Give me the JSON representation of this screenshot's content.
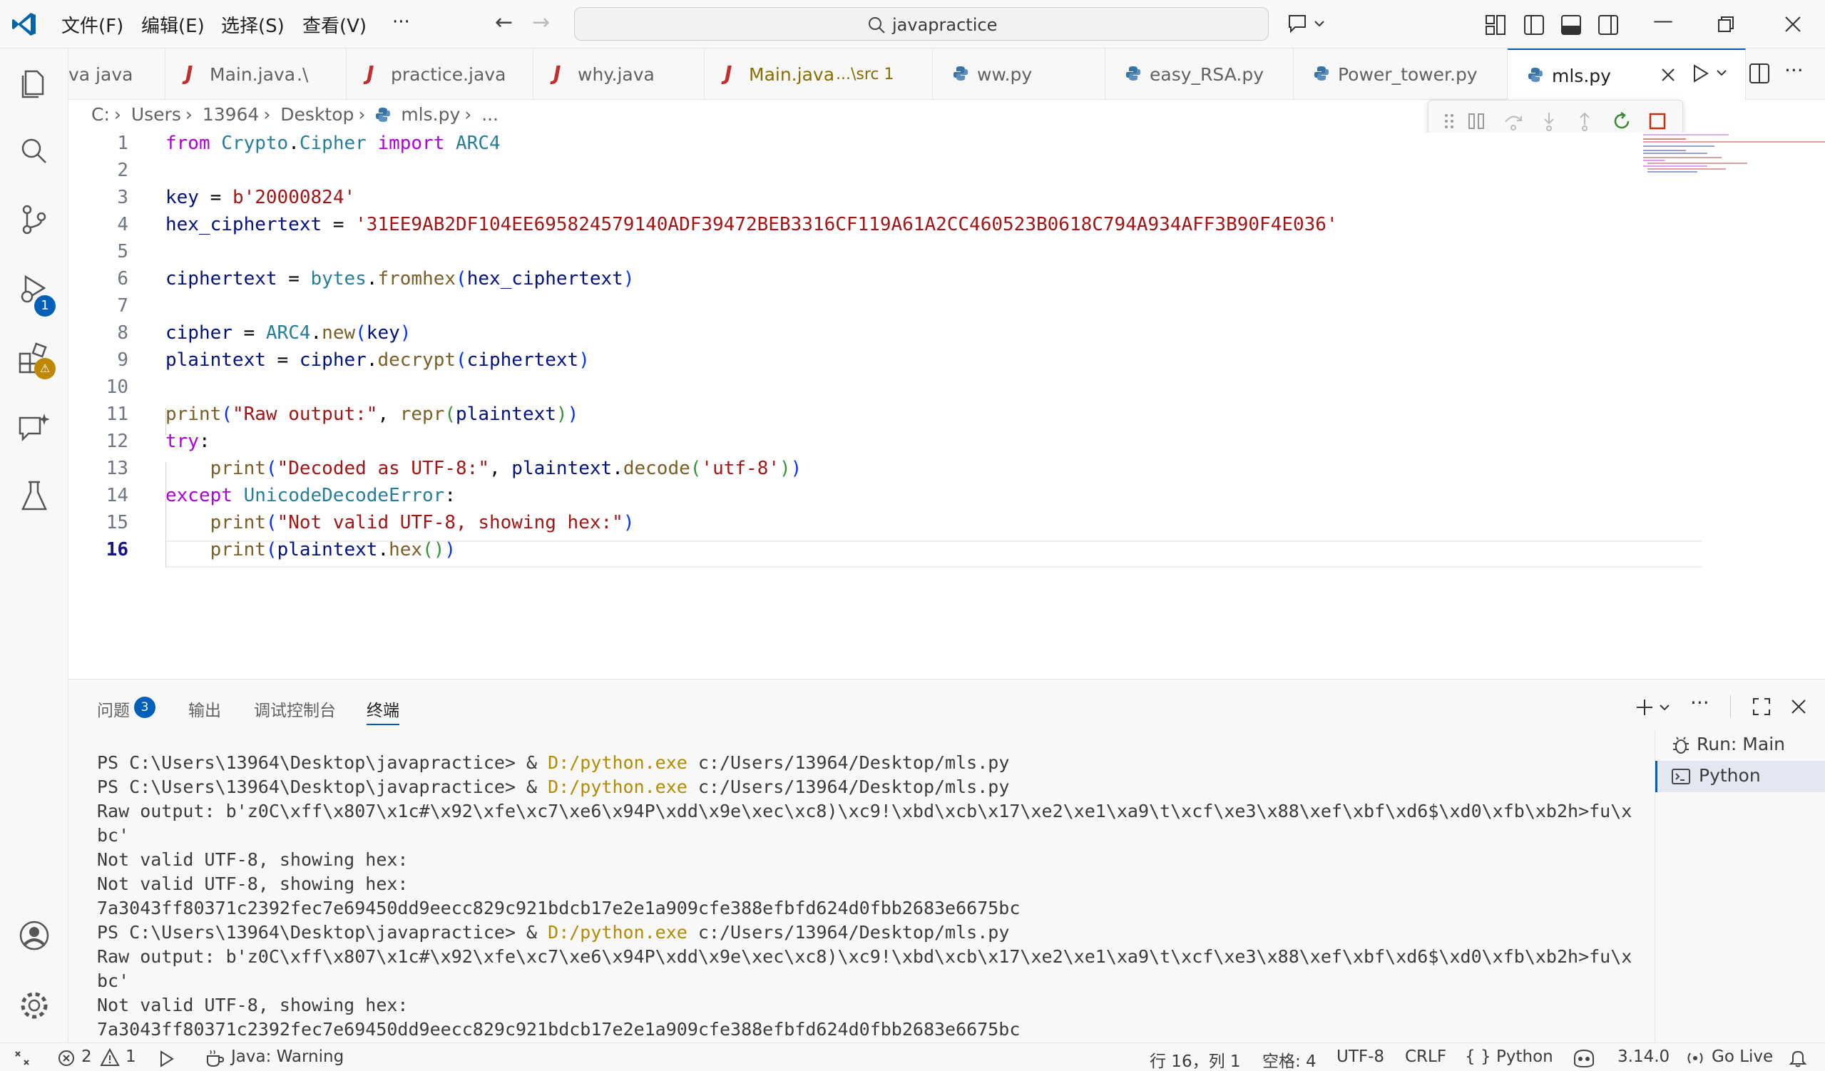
{
  "titlebar": {
    "menu": [
      "文件(F)",
      "编辑(E)",
      "选择(S)",
      "查看(V)",
      "···"
    ],
    "search_text": "javapractice"
  },
  "activity": {
    "debug_badge": "1",
    "extensions_badge": "⚠"
  },
  "tabs": [
    {
      "label": "va  java",
      "kind": "partial"
    },
    {
      "label": "Main.java",
      "desc": ".\\",
      "kind": "java"
    },
    {
      "label": "practice.java",
      "kind": "java"
    },
    {
      "label": "why.java",
      "kind": "java"
    },
    {
      "label": "Main.java",
      "desc": "...\\src 1",
      "kind": "java"
    },
    {
      "label": "ww.py",
      "kind": "python"
    },
    {
      "label": "easy_RSA.py",
      "kind": "python"
    },
    {
      "label": "Power_tower.py",
      "kind": "python"
    },
    {
      "label": "mls.py",
      "kind": "python",
      "active": true
    }
  ],
  "breadcrumb": [
    "C:",
    "Users",
    "13964",
    "Desktop",
    "mls.py",
    "..."
  ],
  "editor": {
    "line_numbers": [
      "1",
      "2",
      "3",
      "4",
      "5",
      "6",
      "7",
      "8",
      "9",
      "10",
      "11",
      "12",
      "13",
      "14",
      "15",
      "16"
    ],
    "lines": {
      "l1": {
        "from": "from",
        "mod": "Crypto",
        "dot": ".",
        "sub": "Cipher",
        "imp": "import",
        "name": "ARC4"
      },
      "l3": {
        "var": "key",
        "eq": " = ",
        "val": "b'20000824'"
      },
      "l4": {
        "var": "hex_ciphertext",
        "eq": " = ",
        "val": "'31EE9AB2DF104EE695824579140ADF39472BEB3316CF119A61A2CC460523B0618C794A934AFF3B90F4E036'"
      },
      "l6": {
        "var": "ciphertext",
        "eq": " = ",
        "cls": "bytes",
        "dot": ".",
        "fn": "fromhex",
        "p1o": "(",
        "arg": "hex_ciphertext",
        "p1c": ")"
      },
      "l8": {
        "var": "cipher",
        "eq": " = ",
        "cls": "ARC4",
        "dot": ".",
        "fn": "new",
        "p1o": "(",
        "arg": "key",
        "p1c": ")"
      },
      "l9": {
        "var": "plaintext",
        "eq": " = ",
        "obj": "cipher",
        "dot": ".",
        "fn": "decrypt",
        "p1o": "(",
        "arg": "ciphertext",
        "p1c": ")"
      },
      "l11": {
        "fn": "print",
        "p1o": "(",
        "str": "\"Raw output:\"",
        "comma": ", ",
        "fn2": "repr",
        "p2o": "(",
        "arg": "plaintext",
        "p2c": ")",
        "p1c": ")"
      },
      "l12": {
        "kw": "try",
        "colon": ":"
      },
      "l13": {
        "fn": "print",
        "p1o": "(",
        "str": "\"Decoded as UTF-8:\"",
        "comma": ", ",
        "obj": "plaintext",
        "dot": ".",
        "fn2": "decode",
        "p2o": "(",
        "arg": "'utf-8'",
        "p2c": ")",
        "p1c": ")"
      },
      "l14": {
        "kw": "except",
        "cls": "UnicodeDecodeError",
        "colon": ":"
      },
      "l15": {
        "fn": "print",
        "p1o": "(",
        "str": "\"Not valid UTF-8, showing hex:\"",
        "p1c": ")"
      },
      "l16": {
        "fn": "print",
        "p1o": "(",
        "obj": "plaintext",
        "dot": ".",
        "fn2": "hex",
        "p2": "()",
        "p1c": ")"
      }
    }
  },
  "panel": {
    "tabs": [
      "问题",
      "输出",
      "调试控制台",
      "终端"
    ],
    "problems_badge": "3",
    "terminal_lines": [
      {
        "pre": "PS C:\\Users\\13964\\Desktop\\javapractice> & ",
        "cmd": "D:/python.exe",
        "post": " c:/Users/13964/Desktop/mls.py"
      },
      {
        "pre": "PS C:\\Users\\13964\\Desktop\\javapractice> & ",
        "cmd": "D:/python.exe",
        "post": " c:/Users/13964/Desktop/mls.py"
      },
      {
        "pre": "Raw output: b'z0C\\xff\\x807\\x1c#\\x92\\xfe\\xc7\\xe6\\x94P\\xdd\\x9e\\xec\\xc8)\\xc9!\\xbd\\xcb\\x17\\xe2\\xe1\\xa9\\t\\xcf\\xe3\\x88\\xef\\xbf\\xd6$\\xd0\\xfb\\xb2h>fu\\x",
        "cmd": "",
        "post": ""
      },
      {
        "pre": "bc'",
        "cmd": "",
        "post": ""
      },
      {
        "pre": "Not valid UTF-8, showing hex:",
        "cmd": "",
        "post": ""
      },
      {
        "pre": "Not valid UTF-8, showing hex:",
        "cmd": "",
        "post": ""
      },
      {
        "pre": "7a3043ff80371c2392fec7e69450dd9eecc829c921bdcb17e2e1a909cfe388efbfd624d0fbb2683e6675bc",
        "cmd": "",
        "post": ""
      },
      {
        "pre": "PS C:\\Users\\13964\\Desktop\\javapractice> & ",
        "cmd": "D:/python.exe",
        "post": " c:/Users/13964/Desktop/mls.py"
      },
      {
        "pre": "Raw output: b'z0C\\xff\\x807\\x1c#\\x92\\xfe\\xc7\\xe6\\x94P\\xdd\\x9e\\xec\\xc8)\\xc9!\\xbd\\xcb\\x17\\xe2\\xe1\\xa9\\t\\xcf\\xe3\\x88\\xef\\xbf\\xd6$\\xd0\\xfb\\xb2h>fu\\x",
        "cmd": "",
        "post": ""
      },
      {
        "pre": "bc'",
        "cmd": "",
        "post": ""
      },
      {
        "pre": "Not valid UTF-8, showing hex:",
        "cmd": "",
        "post": ""
      },
      {
        "pre": "7a3043ff80371c2392fec7e69450dd9eecc829c921bdcb17e2e1a909cfe388efbfd624d0fbb2683e6675bc",
        "cmd": "",
        "post": ""
      }
    ],
    "terminal_list": [
      "Run: Main",
      "Python"
    ]
  },
  "statusbar": {
    "errors": "2",
    "warnings": "1",
    "java": "Java: Warning",
    "position": "行 16，列 1",
    "spaces": "空格: 4",
    "encoding": "UTF-8",
    "eol": "CRLF",
    "language": "Python",
    "lang_prefix": "{ }",
    "version": "3.14.0",
    "golive": "Go Live"
  },
  "colors": {
    "accent": "#005fb8",
    "java_icon": "#c22d2d",
    "python_icon": "#3572a5"
  }
}
